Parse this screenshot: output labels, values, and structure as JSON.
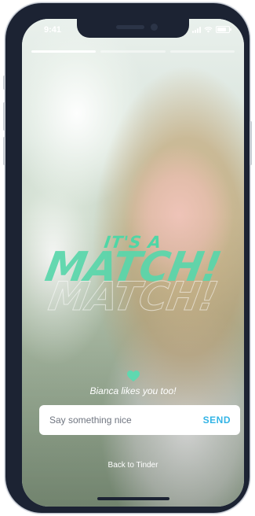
{
  "status_bar": {
    "time": "9:41",
    "icons": [
      "signal-icon",
      "wifi-icon",
      "battery-icon"
    ]
  },
  "story": {
    "segments": 3,
    "active_segment": 1
  },
  "match": {
    "prefix": "IT'S A",
    "title": "MATCH!",
    "color": "#4fd6a6"
  },
  "likes": {
    "icon": "heart-icon",
    "text": "Bianca likes you too!"
  },
  "message": {
    "placeholder": "Say something nice",
    "value": "",
    "send_label": "SEND",
    "send_color": "#33b4e6"
  },
  "footer": {
    "back_label": "Back to Tinder"
  }
}
